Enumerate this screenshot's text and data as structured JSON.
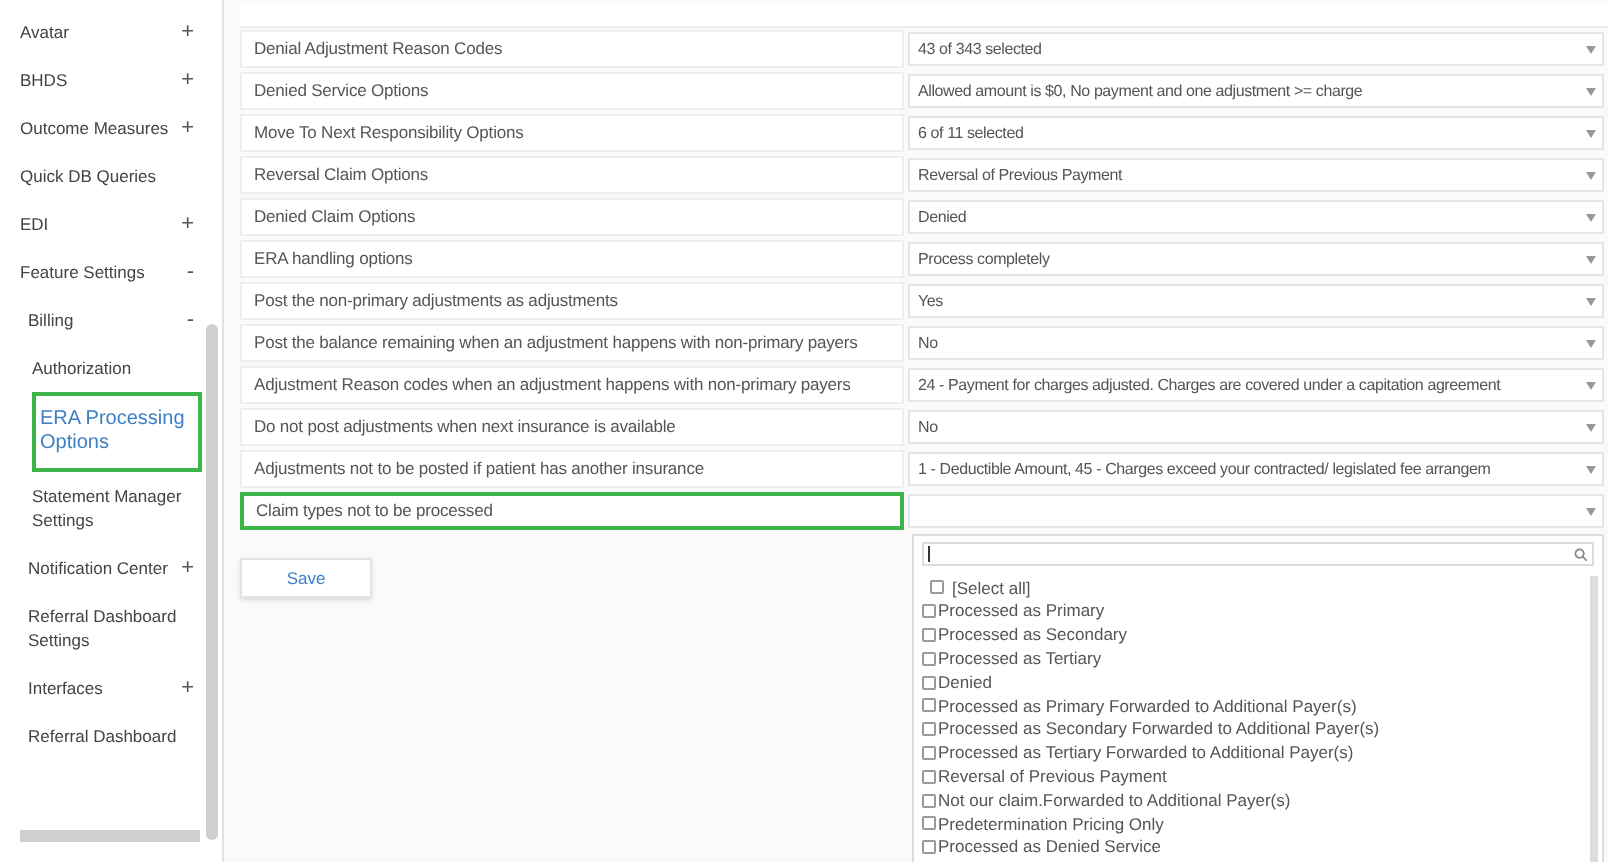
{
  "sidebar": {
    "items": [
      {
        "label": "Avatar",
        "toggle": "+",
        "selected": false
      },
      {
        "label": "BHDS",
        "toggle": "+",
        "selected": false
      },
      {
        "label": "Outcome Measures",
        "toggle": "+",
        "selected": false
      },
      {
        "label": "Quick DB Queries",
        "selected": false
      },
      {
        "label": "EDI",
        "toggle": "+",
        "selected": false
      },
      {
        "label": "Feature Settings",
        "toggle": "-",
        "selected": false,
        "children": [
          {
            "label": "Billing",
            "toggle": "-",
            "selected": false,
            "children": [
              {
                "label": "Authorization",
                "selected": false
              },
              {
                "label": "ERA Processing Options",
                "selected": true
              },
              {
                "label": "Statement Manager Settings",
                "selected": false
              }
            ]
          },
          {
            "label": "Notification Center",
            "toggle": "+",
            "selected": false
          },
          {
            "label": "Referral Dashboard Settings",
            "selected": false
          },
          {
            "label": "Interfaces",
            "toggle": "+",
            "selected": false
          },
          {
            "label": "Referral Dashboard",
            "selected": false
          }
        ]
      }
    ]
  },
  "settings": [
    {
      "label": "Denial Adjustment Reason Codes",
      "value": "43 of 343 selected",
      "highlighted": false
    },
    {
      "label": "Denied Service Options",
      "value": "Allowed amount is $0, No payment and one adjustment >= charge",
      "highlighted": false
    },
    {
      "label": "Move To Next Responsibility Options",
      "value": "6 of 11 selected",
      "highlighted": false
    },
    {
      "label": "Reversal Claim Options",
      "value": "Reversal of Previous Payment",
      "highlighted": false
    },
    {
      "label": "Denied Claim Options",
      "value": "Denied",
      "highlighted": false
    },
    {
      "label": "ERA handling options",
      "value": "Process completely",
      "highlighted": false
    },
    {
      "label": "Post the non-primary adjustments as adjustments",
      "value": "Yes",
      "highlighted": false
    },
    {
      "label": "Post the balance remaining when an adjustment happens with non-primary payers",
      "value": "No",
      "highlighted": false
    },
    {
      "label": "Adjustment Reason codes when an adjustment happens with non-primary payers",
      "value": "24 - Payment for charges adjusted. Charges are covered under a capitation agreement",
      "highlighted": false
    },
    {
      "label": "Do not post adjustments when next insurance is available",
      "value": "No",
      "highlighted": false
    },
    {
      "label": "Adjustments not to be posted if patient has another insurance",
      "value": "1 - Deductible Amount, 45 - Charges exceed your contracted/ legislated fee arrangem",
      "highlighted": false
    },
    {
      "label": "Claim types not to be processed",
      "highlighted": true,
      "expanded": true,
      "options": [
        {
          "label": "[Select all]",
          "checked": false
        },
        {
          "label": "Processed as Primary",
          "checked": false
        },
        {
          "label": "Processed as Secondary",
          "checked": false
        },
        {
          "label": "Processed as Tertiary",
          "checked": false
        },
        {
          "label": "Denied",
          "checked": false
        },
        {
          "label": "Processed as Primary Forwarded to Additional Payer(s)",
          "checked": false
        },
        {
          "label": "Processed as Secondary Forwarded to Additional Payer(s)",
          "checked": false
        },
        {
          "label": "Processed as Tertiary Forwarded to Additional Payer(s)",
          "checked": false
        },
        {
          "label": "Reversal of Previous Payment",
          "checked": false
        },
        {
          "label": "Not our claim.Forwarded to Additional Payer(s)",
          "checked": false
        },
        {
          "label": "Predetermination Pricing Only",
          "checked": false
        },
        {
          "label": "Processed as Denied Service",
          "checked": false
        }
      ]
    }
  ],
  "save_button": "Save"
}
